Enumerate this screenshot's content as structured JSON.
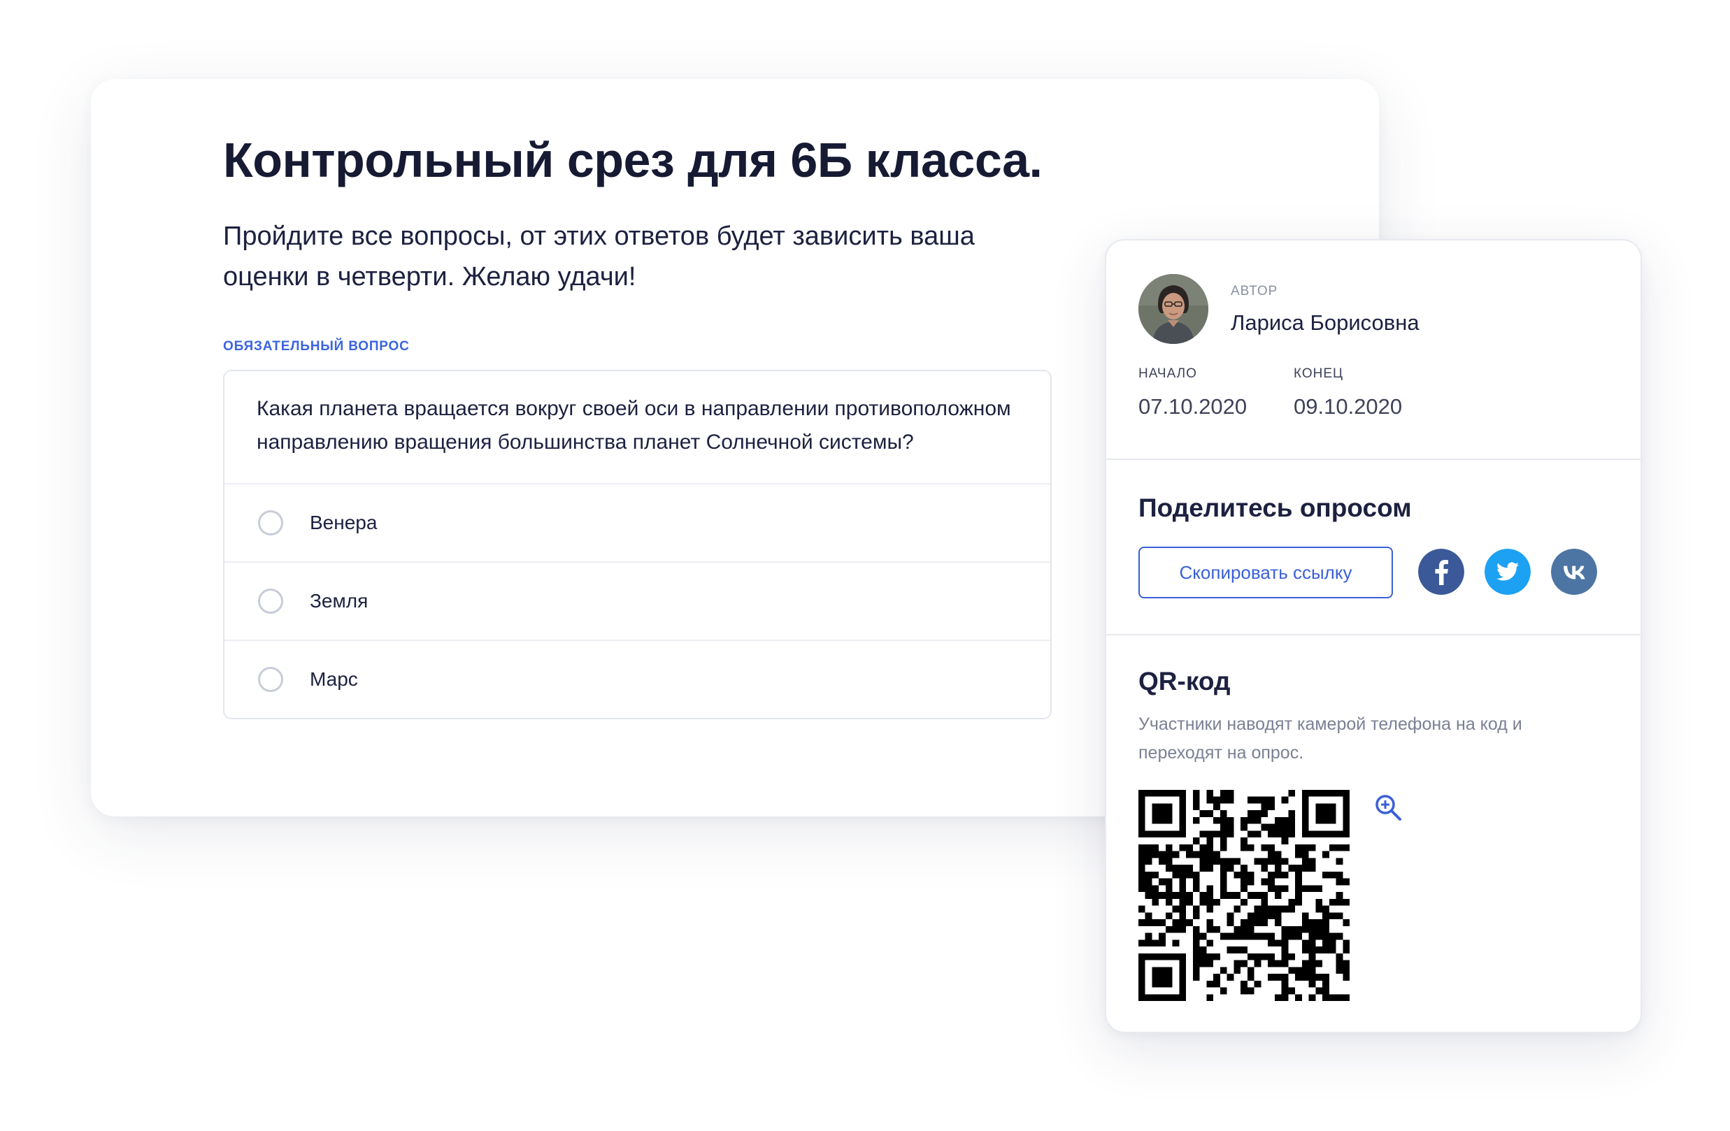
{
  "survey": {
    "title": "Контрольный срез для 6Б класса.",
    "description": "Пройдите все вопросы, от этих ответов будет зависить ваша оценки в четверти. Желаю удачи!",
    "required_label": "ОБЯЗАТЕЛЬНЫЙ ВОПРОС",
    "question": "Какая планета вращается вокруг своей оси в направлении противоположном направлению вращения большинства планет Солнечной системы?",
    "options": [
      {
        "label": "Венера",
        "selected": false
      },
      {
        "label": "Земля",
        "selected": false
      },
      {
        "label": "Марс",
        "selected": false
      }
    ]
  },
  "info": {
    "author_caption": "АВТОР",
    "author_name": "Лариса Борисовна",
    "start_caption": "НАЧАЛО",
    "start_date": "07.10.2020",
    "end_caption": "КОНЕЦ",
    "end_date": "09.10.2020"
  },
  "share": {
    "heading": "Поделитесь опросом",
    "copy_link_label": "Скопировать ссылку",
    "socials": [
      {
        "icon": "facebook-icon",
        "color": "#3b5998"
      },
      {
        "icon": "twitter-icon",
        "color": "#1da1f2"
      },
      {
        "icon": "vk-icon",
        "color": "#4c75a3"
      }
    ]
  },
  "qr": {
    "heading": "QR-код",
    "description": "Участники наводят камерой телефона на код и переходят на опрос.",
    "zoom_icon": "zoom-in-icon"
  },
  "colors": {
    "accent": "#3a60d8",
    "text_dark": "#1d2140",
    "text_muted": "#7b8094",
    "border": "#e8eaf0"
  }
}
